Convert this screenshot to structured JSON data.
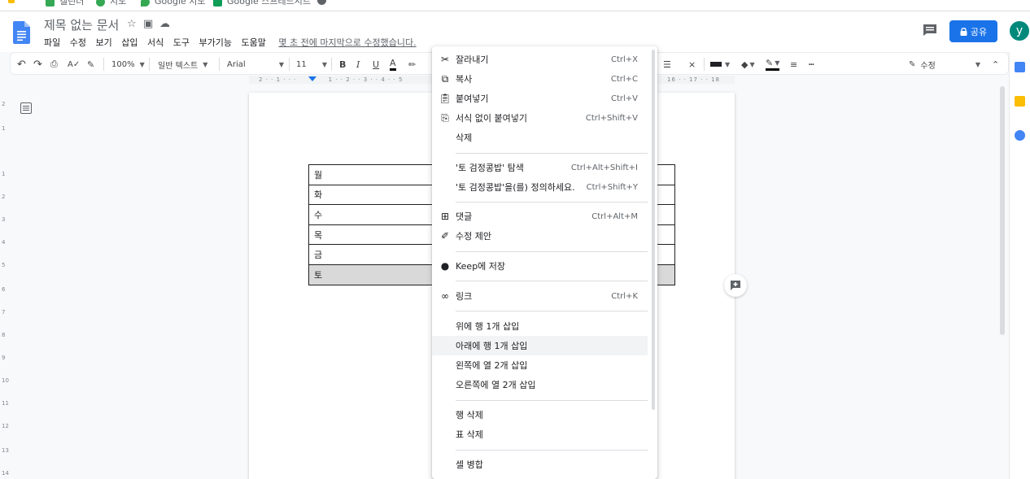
{
  "bookmarks": [
    "캘린더",
    "지도",
    "Google 지도",
    "Google 스프레드시트"
  ],
  "header": {
    "title": "제목 없는 문서",
    "menu": [
      "파일",
      "수정",
      "보기",
      "삽입",
      "서식",
      "도구",
      "부가기능",
      "도움말"
    ],
    "last_edit": "몇 초 전에 마지막으로 수정했습니다.",
    "share_label": "공유",
    "avatar_letter": "y"
  },
  "toolbar": {
    "zoom": "100%",
    "style": "일반 텍스트",
    "font": "Arial",
    "size": "11",
    "mode": "수정"
  },
  "ruler": {
    "left_text": "2 · · 1 · · ·",
    "mid_text": "1 · · 2 · · 3 · · 4 · · 5",
    "right_text": "16 · · 17 · · 18"
  },
  "vruler": [
    "2",
    "1",
    "1",
    "2",
    "3",
    "4",
    "5",
    "6",
    "7",
    "8",
    "9",
    "10",
    "11",
    "12",
    "13",
    "14"
  ],
  "table": {
    "rows": [
      "월",
      "화",
      "수",
      "목",
      "금",
      "토"
    ],
    "selected_row": 5
  },
  "context_menu": {
    "items": [
      {
        "label": "잘라내기",
        "shortcut": "Ctrl+X",
        "icon": "cut-icon"
      },
      {
        "label": "복사",
        "shortcut": "Ctrl+C",
        "icon": "copy-icon"
      },
      {
        "label": "붙여넣기",
        "shortcut": "Ctrl+V",
        "icon": "paste-icon"
      },
      {
        "label": "서식 없이 붙여넣기",
        "shortcut": "Ctrl+Shift+V",
        "icon": "paste-plain-icon"
      },
      {
        "label": "삭제",
        "shortcut": "",
        "icon": ""
      },
      {
        "label": "'토 검정콩밥' 탐색",
        "shortcut": "Ctrl+Alt+Shift+I",
        "icon": ""
      },
      {
        "label": "'토 검정콩밥'을(를) 정의하세요.",
        "shortcut": "Ctrl+Shift+Y",
        "icon": ""
      },
      {
        "label": "댓글",
        "shortcut": "Ctrl+Alt+M",
        "icon": "comment-add-icon"
      },
      {
        "label": "수정 제안",
        "shortcut": "",
        "icon": "suggest-edit-icon"
      },
      {
        "label": "Keep에 저장",
        "shortcut": "",
        "icon": "keep-bulb-icon"
      },
      {
        "label": "링크",
        "shortcut": "Ctrl+K",
        "icon": "link-icon"
      },
      {
        "label": "위에 행 1개 삽입",
        "shortcut": "",
        "icon": ""
      },
      {
        "label": "아래에 행 1개 삽입",
        "shortcut": "",
        "icon": ""
      },
      {
        "label": "왼쪽에 열 2개 삽입",
        "shortcut": "",
        "icon": ""
      },
      {
        "label": "오른쪽에 열 2개 삽입",
        "shortcut": "",
        "icon": ""
      },
      {
        "label": "행 삭제",
        "shortcut": "",
        "icon": ""
      },
      {
        "label": "표 삭제",
        "shortcut": "",
        "icon": ""
      },
      {
        "label": "셀 병합",
        "shortcut": "",
        "icon": ""
      }
    ],
    "hovered_index": 12
  },
  "colors": {
    "accent": "#1a73e8",
    "avatar": "#00897b",
    "selected_row": "#d9d9d9"
  }
}
